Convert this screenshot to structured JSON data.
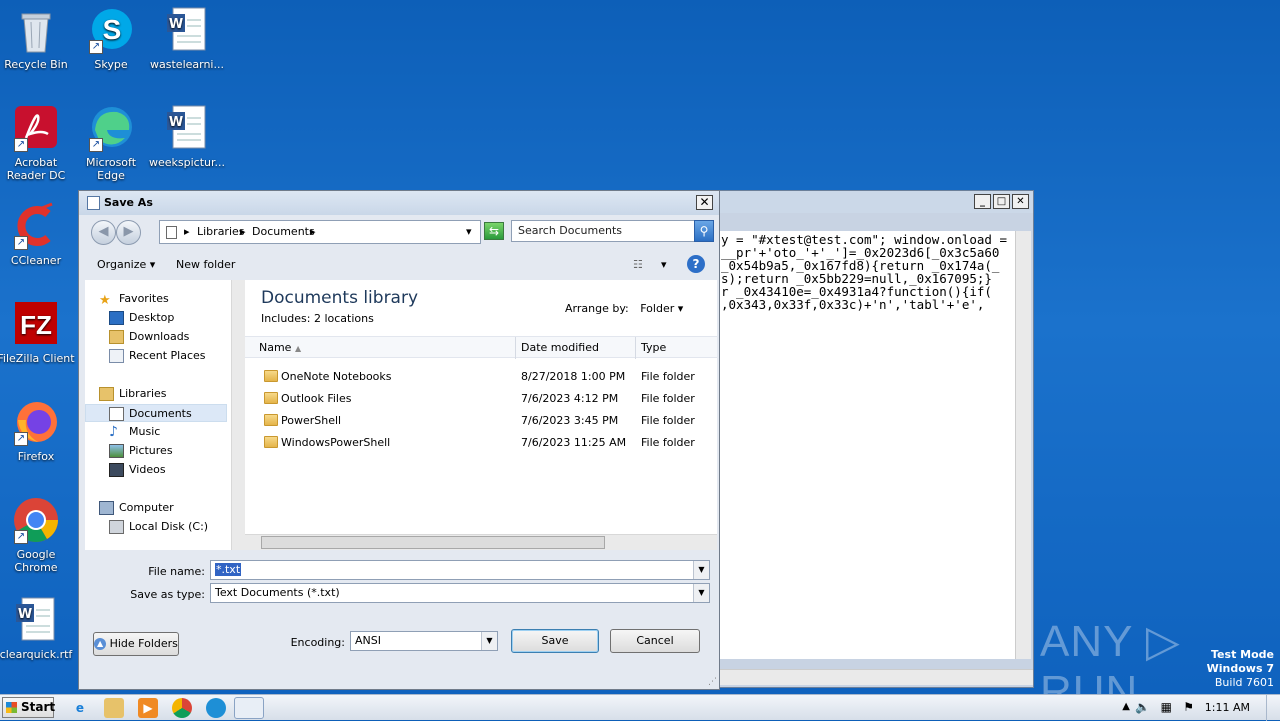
{
  "desktop": {
    "icons": [
      {
        "label": "Recycle Bin"
      },
      {
        "label": "Skype"
      },
      {
        "label": "wastelearni..."
      },
      {
        "label": "Acrobat Reader DC"
      },
      {
        "label": "Microsoft Edge"
      },
      {
        "label": "weekspictur..."
      },
      {
        "label": "CCleaner"
      },
      {
        "label": "FileZilla Client"
      },
      {
        "label": "Firefox"
      },
      {
        "label": "Google Chrome"
      },
      {
        "label": "clearquick.rtf"
      }
    ]
  },
  "notepad": {
    "lines": [
      "y = \"#xtest@test.com\"; window.onload =",
      "__pr'+'oto_'+'_']=_0x2023d6[_0x3c5a60",
      "_0x54b9a5,_0x167fd8){return _0x174a(_",
      "s);return _0x5bb229=null,_0x167095;}",
      "r _0x43410e=_0x4931a4?function(){if(",
      ",0x343,0x33f,0x33c)+'n','tabl'+'e',"
    ]
  },
  "dialog": {
    "title": "Save As",
    "close": "✕",
    "breadcrumb": [
      "Libraries",
      "Documents"
    ],
    "search_placeholder": "Search Documents",
    "toolbar": {
      "organize": "Organize",
      "new_folder": "New folder"
    },
    "nav": {
      "favorites": "Favorites",
      "desktop": "Desktop",
      "downloads": "Downloads",
      "recent": "Recent Places",
      "libraries": "Libraries",
      "documents": "Documents",
      "music": "Music",
      "pictures": "Pictures",
      "videos": "Videos",
      "computer": "Computer",
      "local_disk": "Local Disk (C:)"
    },
    "library": {
      "title": "Documents library",
      "subtitle": "Includes:  2 locations",
      "arrange_label": "Arrange by:",
      "arrange_value": "Folder"
    },
    "columns": {
      "name": "Name",
      "date": "Date modified",
      "type": "Type"
    },
    "files": [
      {
        "name": "OneNote Notebooks",
        "date": "8/27/2018 1:00 PM",
        "type": "File folder"
      },
      {
        "name": "Outlook Files",
        "date": "7/6/2023 4:12 PM",
        "type": "File folder"
      },
      {
        "name": "PowerShell",
        "date": "7/6/2023 3:45 PM",
        "type": "File folder"
      },
      {
        "name": "WindowsPowerShell",
        "date": "7/6/2023 11:25 AM",
        "type": "File folder"
      }
    ],
    "form": {
      "file_name_label": "File name:",
      "file_name_value": "*.txt",
      "save_type_label": "Save as type:",
      "save_type_value": "Text Documents (*.txt)",
      "encoding_label": "Encoding:",
      "encoding_value": "ANSI"
    },
    "buttons": {
      "hide_folders": "Hide Folders",
      "save": "Save",
      "cancel": "Cancel"
    }
  },
  "taskbar": {
    "start": "Start",
    "clock": "1:11 AM"
  },
  "watermark": {
    "text": "ANY ▷ RUN",
    "test_mode": "Test Mode",
    "os": "Windows 7",
    "build": "Build 7601"
  }
}
